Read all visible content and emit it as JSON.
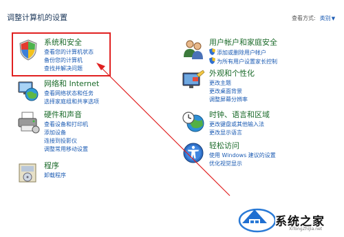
{
  "header": {
    "title": "调整计算机的设置",
    "view_by_label": "查看方式:",
    "view_by_value": "类别"
  },
  "categories": [
    {
      "name": "系统和安全",
      "links": [
        "查看您的计算机状态",
        "备份您的计算机",
        "查找并解决问题"
      ]
    },
    {
      "name": "网络和 Internet",
      "links": [
        "查看网络状态和任务",
        "选择家庭组和共享选项"
      ]
    },
    {
      "name": "硬件和声音",
      "links": [
        "查看设备和打印机",
        "添加设备",
        "连接到投影仪",
        "调整常用移动设置"
      ]
    },
    {
      "name": "程序",
      "links": [
        "卸载程序"
      ]
    },
    {
      "name": "用户帐户和家庭安全",
      "links": [
        "添加或删除用户帐户",
        "为所有用户设置家长控制"
      ]
    },
    {
      "name": "外观和个性化",
      "links": [
        "更改主题",
        "更改桌面背景",
        "调整屏幕分辨率"
      ]
    },
    {
      "name": "时钟、语言和区域",
      "links": [
        "更改键盘或其他输入法",
        "更改显示语言"
      ]
    },
    {
      "name": "轻松访问",
      "links": [
        "使用 Windows 建议的设置",
        "优化视觉显示"
      ]
    }
  ],
  "icons": [
    "shield-icon",
    "network-globe-icon",
    "printer-icon",
    "programs-icon",
    "users-icon",
    "appearance-icon",
    "clock-globe-icon",
    "accessibility-icon"
  ],
  "watermark": {
    "text": "系统之家",
    "url": "XiTongZhiJia.net"
  },
  "colors": {
    "link": "#1b5bb3",
    "heading": "#1a6a29",
    "highlight": "#e02020"
  }
}
